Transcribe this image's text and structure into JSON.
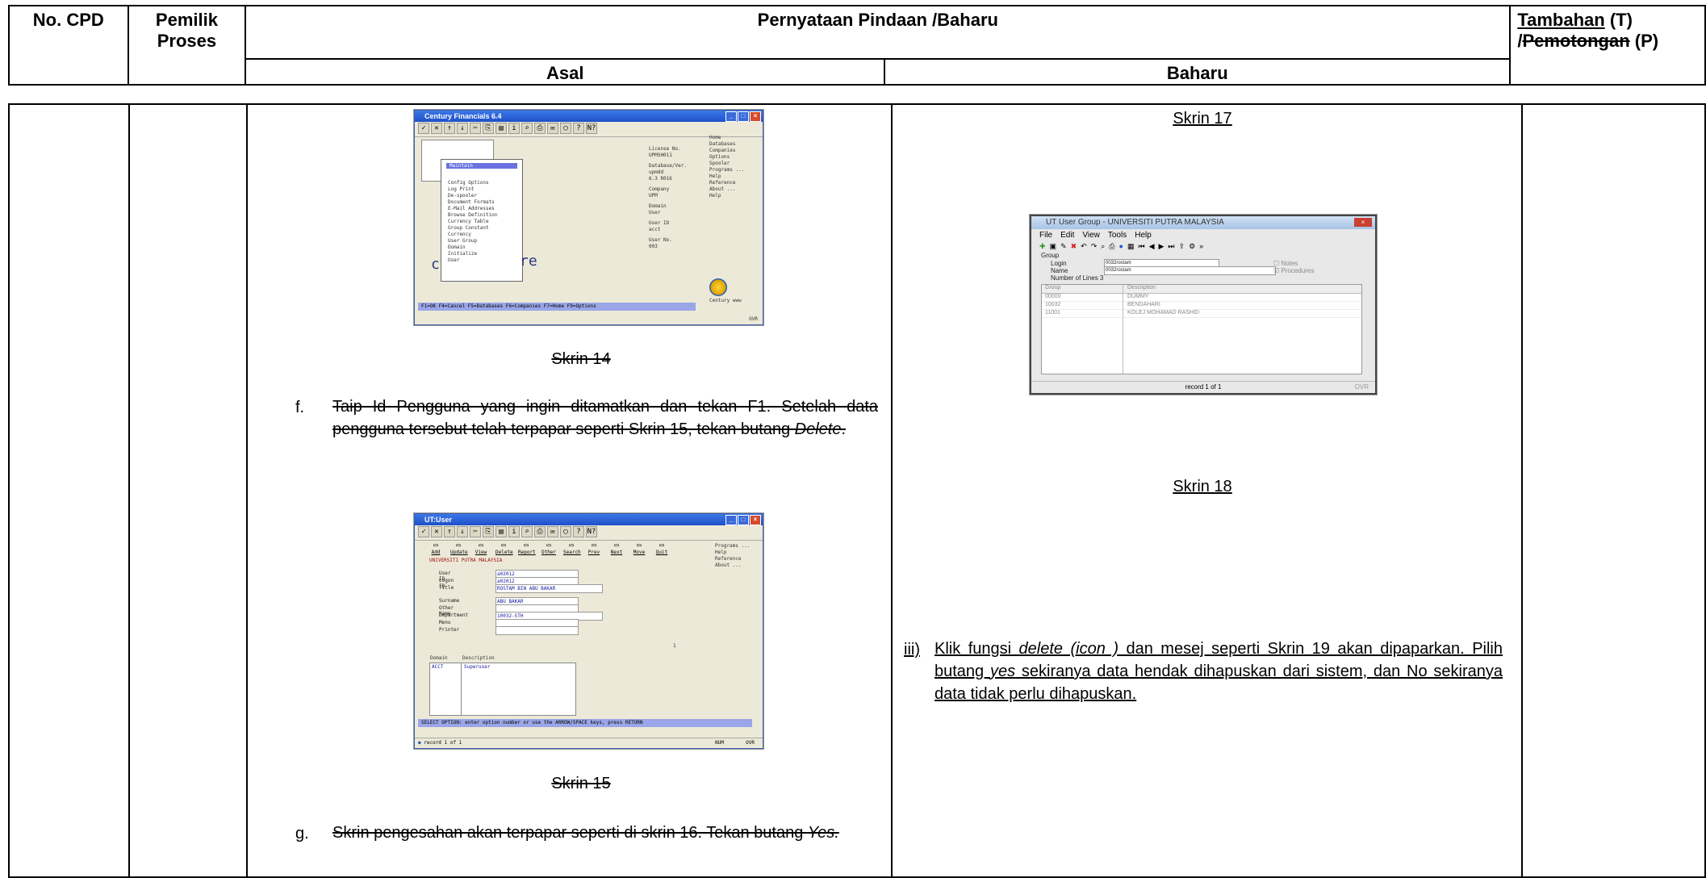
{
  "header": {
    "col_no_cpd": "No. CPD",
    "col_pemilik": "Pemilik Proses",
    "col_pernyataan": "Pernyataan Pindaan /Baharu",
    "col_asal": "Asal",
    "col_baharu": "Baharu",
    "col_tambahan_t": "Tambahan",
    "col_tambahan_t_suffix": " (T)",
    "col_tambahan_slash": "/",
    "col_tambahan_p": "Pemotongan",
    "col_tambahan_p_suffix": " (P)"
  },
  "asal": {
    "screen14": {
      "title": "Century Financials 6.4",
      "menu_items": [
        "Config Options",
        "Log Print",
        "De-spooler",
        "Document Formats",
        "E-Mail Addresses",
        "Browse Definition",
        "Currency Table",
        "Group Constant",
        "Currency",
        "User Group",
        "Domain",
        "Initialize",
        "User"
      ],
      "highlight": "Maintain",
      "right_labels": [
        "License No.",
        "UPMSH011",
        "Database/Ver.",
        "upmdd",
        "6.3 R016",
        "Company",
        "UPM",
        "Domain",
        "User",
        "User ID",
        "acct",
        "User No.",
        "003"
      ],
      "side_menu": [
        "Home",
        "Databases",
        "Companies",
        "Options",
        "Spooler",
        "Programs ...",
        "Help",
        "Reference",
        "About ...",
        "Help"
      ],
      "footer": "F1=OK  F4=Cancel  F5=Databases  F6=Companies  F7=Home  F9=Options",
      "brand": "Century www",
      "status": "OVR"
    },
    "caption14": "Skrin 14",
    "step_f_num": "f.",
    "step_f_text1": "Taip Id Pengguna yang ingin ditamatkan dan tekan F1. Setelah data pengguna tersebut telah terpapar seperti Skrin 15, tekan butang ",
    "step_f_italic": "Delete",
    "step_f_end": ".",
    "screen15": {
      "title": "UT:User",
      "buttons": [
        "Add",
        "Update",
        "View",
        "Delete",
        "Report",
        "Other",
        "Search",
        "Prev",
        "Next",
        "Move",
        "Quit"
      ],
      "org": "UNIVERSITI PUTRA MALAYSIA",
      "labels": [
        "User ID",
        "Logon ID",
        "Title",
        "Surname",
        "Other Name",
        "Department",
        "Menu",
        "Printer"
      ],
      "values": [
        "a02012",
        "a02012",
        "ROSTAM BIN ABU BAKAR",
        "ABU BAKAR",
        "",
        "10032-STH",
        "",
        ""
      ],
      "grid_head_domain": "Domain",
      "grid_head_desc": "Description",
      "grid_row_domain": "ACCT",
      "grid_row_desc": "Superuser",
      "side_menu": [
        "Programs ...",
        "Help",
        "Reference",
        "About ..."
      ],
      "select_bar": "SELECT OPTION: enter option number or use the ARROW/SPACE keys, press RETURN",
      "status": "record 1 of 1",
      "status_num": "NUM",
      "status_ovr": "OVR",
      "count": "1"
    },
    "caption15": "Skrin 15",
    "step_g_num": "g.",
    "step_g_text1": "Skrin pengesahan akan terpapar seperti di skrin 16.  Tekan butang ",
    "step_g_italic": "Yes."
  },
  "baharu": {
    "caption17": "Skrin 17",
    "screen17": {
      "title": "UT User Group - UNIVERSITI PUTRA MALAYSIA",
      "menu": [
        "File",
        "Edit",
        "View",
        "Tools",
        "Help"
      ],
      "group_label": "Group",
      "login_label": "Login",
      "login_value": "0032rostam",
      "name_label": "Name",
      "name_value": "0032rostam",
      "lines_label": "Number of Lines 3",
      "notes": "Notes",
      "procedures": "Procedures",
      "col_group": "Group",
      "col_desc": "Description",
      "rows": [
        [
          "00000",
          "DUMMY"
        ],
        [
          "10032",
          "BENDAHARI"
        ],
        [
          "11001",
          "KOLEJ MOHAMAD RASHID"
        ]
      ],
      "status": "record 1 of 1",
      "status_ovr": "OVR"
    },
    "caption18": "Skrin 18",
    "step_iii_num": "iii)",
    "step_iii_a": "Klik fungsi ",
    "step_iii_italic1": "delete (icon )",
    "step_iii_b": " dan mesej seperti Skrin 19 akan dipaparkan. Pilih butang ",
    "step_iii_italic2": "yes",
    "step_iii_c": " sekiranya data hendak dihapuskan dari sistem, dan No sekiranya data tidak perlu dihapuskan."
  }
}
